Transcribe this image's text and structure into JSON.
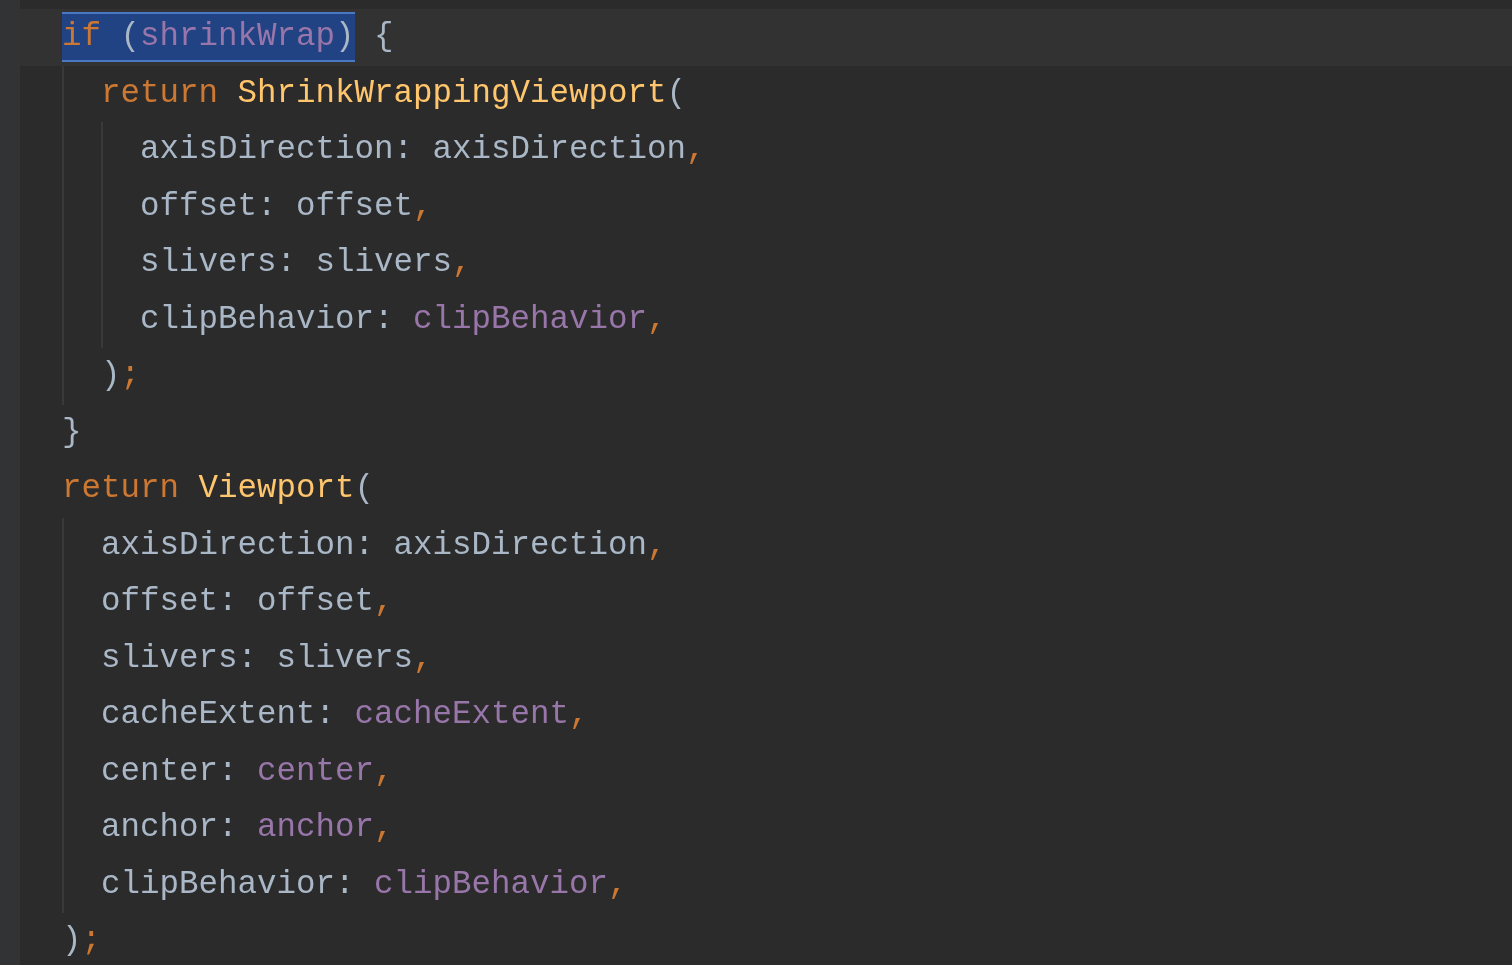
{
  "editor": {
    "lines": [
      {
        "current": true,
        "tokens": [
          {
            "kind": "keyword",
            "text": "if",
            "selected": true
          },
          {
            "kind": "plain",
            "text": " (",
            "selected": true
          },
          {
            "kind": "field",
            "text": "shrinkWrap",
            "selected": true
          },
          {
            "kind": "plain",
            "text": ")",
            "selected": true
          },
          {
            "kind": "plain",
            "text": " {",
            "selected": false
          }
        ],
        "children": [
          {
            "current": false,
            "tokens": [
              {
                "kind": "keyword",
                "text": "return ",
                "selected": false
              },
              {
                "kind": "class",
                "text": "ShrinkWrappingViewport",
                "selected": false
              },
              {
                "kind": "plain",
                "text": "(",
                "selected": false
              }
            ],
            "children": [
              {
                "current": false,
                "tokens": [
                  {
                    "kind": "plain",
                    "text": "axisDirection: axisDirection",
                    "selected": false
                  },
                  {
                    "kind": "punct",
                    "text": ",",
                    "selected": false
                  }
                ]
              },
              {
                "current": false,
                "tokens": [
                  {
                    "kind": "plain",
                    "text": "offset: offset",
                    "selected": false
                  },
                  {
                    "kind": "punct",
                    "text": ",",
                    "selected": false
                  }
                ]
              },
              {
                "current": false,
                "tokens": [
                  {
                    "kind": "plain",
                    "text": "slivers: slivers",
                    "selected": false
                  },
                  {
                    "kind": "punct",
                    "text": ",",
                    "selected": false
                  }
                ]
              },
              {
                "current": false,
                "tokens": [
                  {
                    "kind": "plain",
                    "text": "clipBehavior: ",
                    "selected": false
                  },
                  {
                    "kind": "field",
                    "text": "clipBehavior",
                    "selected": false
                  },
                  {
                    "kind": "punct",
                    "text": ",",
                    "selected": false
                  }
                ]
              }
            ]
          },
          {
            "current": false,
            "tokens": [
              {
                "kind": "plain",
                "text": ")",
                "selected": false
              },
              {
                "kind": "punct",
                "text": ";",
                "selected": false
              }
            ]
          }
        ]
      },
      {
        "current": false,
        "tokens": [
          {
            "kind": "plain",
            "text": "}",
            "selected": false
          }
        ]
      },
      {
        "current": false,
        "tokens": [
          {
            "kind": "keyword",
            "text": "return ",
            "selected": false
          },
          {
            "kind": "class",
            "text": "Viewport",
            "selected": false
          },
          {
            "kind": "plain",
            "text": "(",
            "selected": false
          }
        ],
        "children": [
          {
            "current": false,
            "tokens": [
              {
                "kind": "plain",
                "text": "axisDirection: axisDirection",
                "selected": false
              },
              {
                "kind": "punct",
                "text": ",",
                "selected": false
              }
            ]
          },
          {
            "current": false,
            "tokens": [
              {
                "kind": "plain",
                "text": "offset: offset",
                "selected": false
              },
              {
                "kind": "punct",
                "text": ",",
                "selected": false
              }
            ]
          },
          {
            "current": false,
            "tokens": [
              {
                "kind": "plain",
                "text": "slivers: slivers",
                "selected": false
              },
              {
                "kind": "punct",
                "text": ",",
                "selected": false
              }
            ]
          },
          {
            "current": false,
            "tokens": [
              {
                "kind": "plain",
                "text": "cacheExtent: ",
                "selected": false
              },
              {
                "kind": "field",
                "text": "cacheExtent",
                "selected": false
              },
              {
                "kind": "punct",
                "text": ",",
                "selected": false
              }
            ]
          },
          {
            "current": false,
            "tokens": [
              {
                "kind": "plain",
                "text": "center: ",
                "selected": false
              },
              {
                "kind": "field",
                "text": "center",
                "selected": false
              },
              {
                "kind": "punct",
                "text": ",",
                "selected": false
              }
            ]
          },
          {
            "current": false,
            "tokens": [
              {
                "kind": "plain",
                "text": "anchor: ",
                "selected": false
              },
              {
                "kind": "field",
                "text": "anchor",
                "selected": false
              },
              {
                "kind": "punct",
                "text": ",",
                "selected": false
              }
            ]
          },
          {
            "current": false,
            "tokens": [
              {
                "kind": "plain",
                "text": "clipBehavior: ",
                "selected": false
              },
              {
                "kind": "field",
                "text": "clipBehavior",
                "selected": false
              },
              {
                "kind": "punct",
                "text": ",",
                "selected": false
              }
            ]
          }
        ]
      },
      {
        "current": false,
        "tokens": [
          {
            "kind": "plain",
            "text": ")",
            "selected": false
          },
          {
            "kind": "punct",
            "text": ";",
            "selected": false
          }
        ]
      }
    ]
  }
}
